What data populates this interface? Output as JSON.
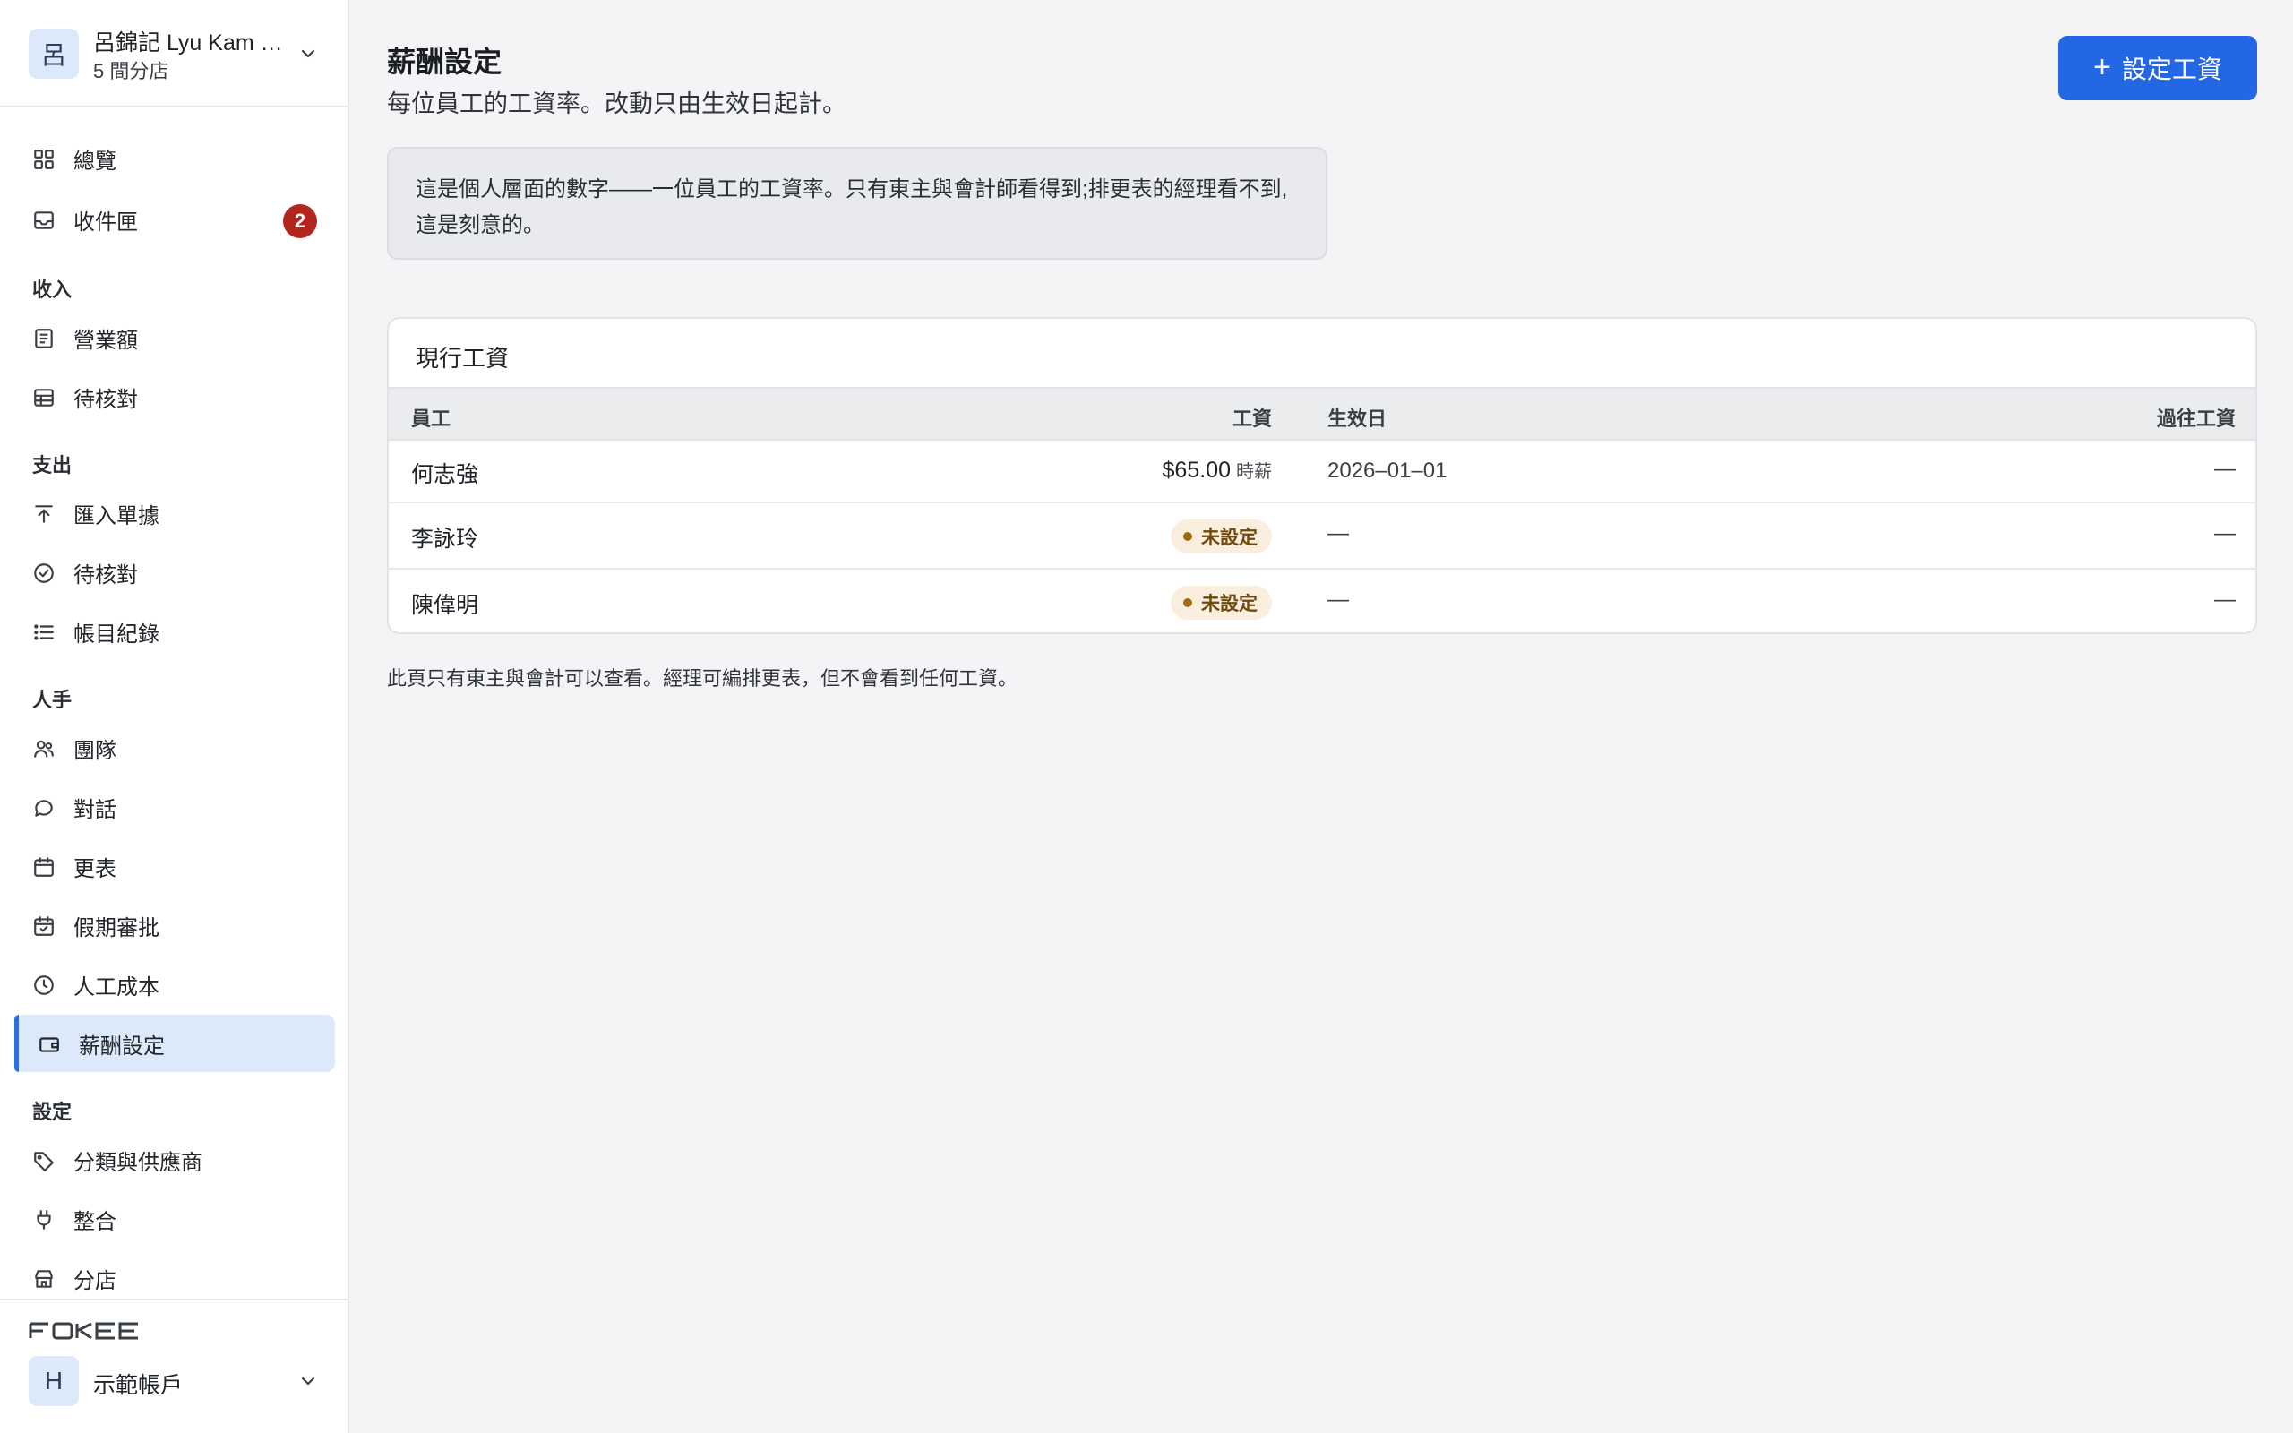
{
  "org": {
    "avatar": "呂",
    "name": "呂錦記 Lyu Kam …",
    "sub": "5 間分店"
  },
  "nav": {
    "overview": "總覽",
    "inbox": "收件匣",
    "inbox_badge": "2",
    "section_income": "收入",
    "sales": "營業額",
    "income_review": "待核對",
    "section_expense": "支出",
    "import_receipts": "匯入單據",
    "expense_review": "待核對",
    "ledger": "帳目紀錄",
    "section_staff": "人手",
    "team": "團隊",
    "chat": "對話",
    "rota": "更表",
    "leave": "假期審批",
    "labour_cost": "人工成本",
    "payroll": "薪酬設定",
    "section_settings": "設定",
    "categories": "分類與供應商",
    "integrations": "整合",
    "branches": "分店"
  },
  "account": {
    "avatar": "H",
    "name": "示範帳戶"
  },
  "header": {
    "title": "薪酬設定",
    "subtitle": "每位員工的工資率。改動只由生效日起計。",
    "set_pay_button": "設定工資"
  },
  "notice": "這是個人層面的數字——一位員工的工資率。只有東主與會計師看得到;排更表的經理看不到,這是刻意的。",
  "table": {
    "title": "現行工資",
    "headers": {
      "employee": "員工",
      "pay": "工資",
      "effective": "生效日",
      "history": "過往工資"
    },
    "rows": [
      {
        "name": "何志強",
        "pay": "$65.00",
        "unit": "時薪",
        "effective": "2026–01–01",
        "history": "—"
      },
      {
        "name": "李詠玲",
        "status": "未設定",
        "effective": "—",
        "history": "—"
      },
      {
        "name": "陳偉明",
        "status": "未設定",
        "effective": "—",
        "history": "—"
      }
    ]
  },
  "footnote": "此頁只有東主與會計可以查看。經理可編排更表，但不會看到任何工資。",
  "colors": {
    "accent": "#2467e5",
    "active_bg": "#dbe9fa",
    "badge": "#b3261e",
    "pill_bg": "#faefdf"
  }
}
